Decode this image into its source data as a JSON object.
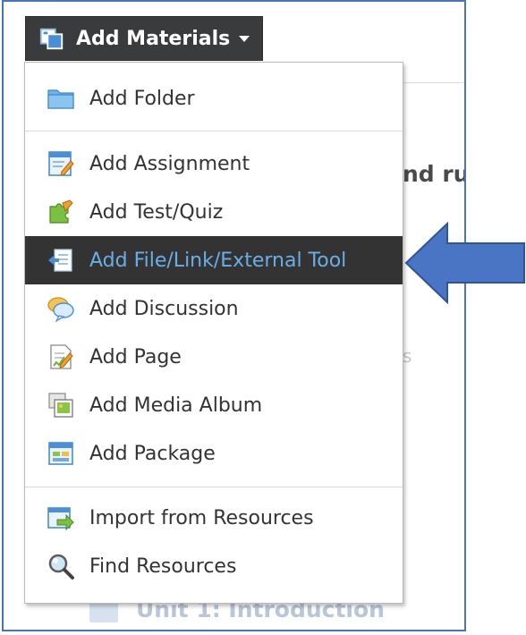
{
  "toolbar": {
    "button_label": "Add Materials",
    "button_icon": "add-materials-icon"
  },
  "background": {
    "heading_fragment": "nd ru",
    "faint_fragment": "s",
    "unit_label": "Unit 1: Introduction"
  },
  "menu": {
    "items": [
      {
        "label": "Add Folder",
        "icon": "folder-icon"
      },
      {
        "label": "Add Assignment",
        "icon": "assignment-icon"
      },
      {
        "label": "Add Test/Quiz",
        "icon": "puzzle-icon"
      },
      {
        "label": "Add File/Link/External Tool",
        "icon": "file-link-icon",
        "highlighted": true
      },
      {
        "label": "Add Discussion",
        "icon": "discussion-icon"
      },
      {
        "label": "Add Page",
        "icon": "page-icon"
      },
      {
        "label": "Add Media Album",
        "icon": "media-album-icon"
      },
      {
        "label": "Add Package",
        "icon": "package-icon"
      },
      {
        "label": "Import from Resources",
        "icon": "import-icon"
      },
      {
        "label": "Find Resources",
        "icon": "magnifier-icon"
      }
    ]
  },
  "colors": {
    "button_bg": "#3a3b3c",
    "highlight_bg": "#333333",
    "highlight_text": "#6aaee6",
    "annotation_arrow": "#4a74c4"
  }
}
